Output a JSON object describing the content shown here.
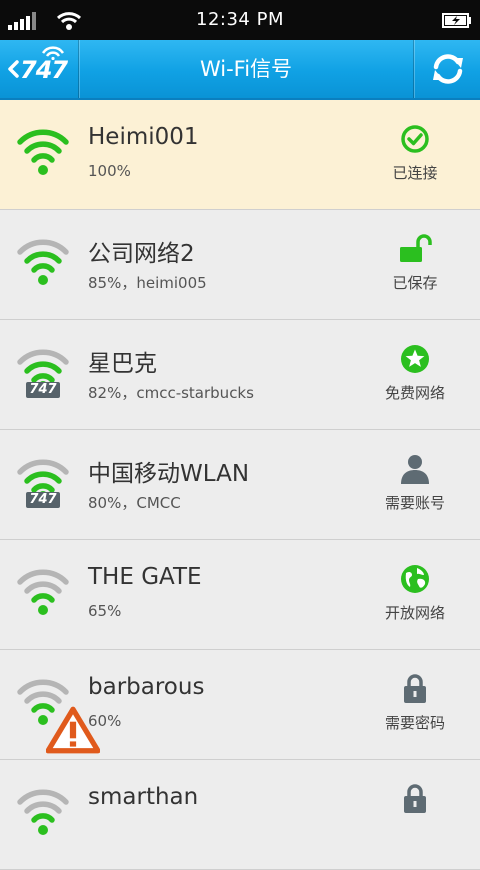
{
  "status_bar": {
    "time": "12:34 PM"
  },
  "header": {
    "back_logo": "747",
    "title": "Wi-Fi信号"
  },
  "colors": {
    "accent_blue": "#10a1e4",
    "wifi_green": "#2bbf1f",
    "wifi_gray": "#b5b5b5",
    "connected_bg": "#fcf1d5",
    "icon_gray": "#5e6b73"
  },
  "networks": [
    {
      "ssid": "Heimi001",
      "detail": "100%",
      "status": "已连接",
      "status_icon": "check-circle-icon"
    },
    {
      "ssid": "公司网络2",
      "detail": "85%，heimi005",
      "status": "已保存",
      "status_icon": "unlock-icon"
    },
    {
      "ssid": "星巴克",
      "detail": "82%，cmcc-starbucks",
      "status": "免费网络",
      "status_icon": "star-circle-icon",
      "badge": "747"
    },
    {
      "ssid": "中国移动WLAN",
      "detail": "80%，CMCC",
      "status": "需要账号",
      "status_icon": "user-icon",
      "badge": "747"
    },
    {
      "ssid": "THE GATE",
      "detail": "65%",
      "status": "开放网络",
      "status_icon": "globe-icon"
    },
    {
      "ssid": "barbarous",
      "detail": "60%",
      "status": "需要密码",
      "status_icon": "lock-icon"
    },
    {
      "ssid": "smarthan",
      "detail": "",
      "status": "",
      "status_icon": "lock-icon"
    }
  ]
}
